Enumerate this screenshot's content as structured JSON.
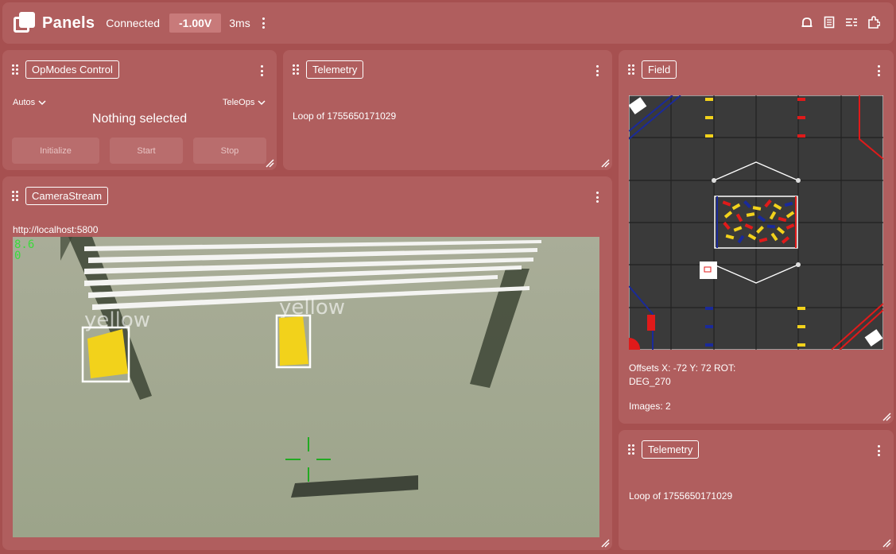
{
  "app": {
    "brand": "Panels",
    "status": "Connected",
    "voltage": "-1.00V",
    "latency": "3ms"
  },
  "toolbar_icons": [
    "bell-icon",
    "document-icon",
    "list-settings-icon",
    "puzzle-icon"
  ],
  "opmodes": {
    "title": "OpModes Control",
    "autos_label": "Autos",
    "teleops_label": "TeleOps",
    "selection": "Nothing selected",
    "initialize_label": "Initialize",
    "start_label": "Start",
    "stop_label": "Stop"
  },
  "telemetry_top": {
    "title": "Telemetry",
    "line": "Loop of 1755650171029"
  },
  "camera": {
    "title": "CameraStream",
    "url": "http://localhost:5800",
    "fps_overlay": "8.6\n0",
    "detections": [
      {
        "label": "yellow"
      },
      {
        "label": "yellow"
      }
    ]
  },
  "field": {
    "title": "Field",
    "offsets": "Offsets X: -72 Y: 72 ROT:",
    "rotation": "DEG_270",
    "images": "Images: 2"
  },
  "telemetry_bottom": {
    "title": "Telemetry",
    "line": "Loop of 1755650171029"
  },
  "colors": {
    "background": "#a65050",
    "panel": "#b05e5e",
    "field_tile": "#3a3a3a",
    "alliance_red": "#e01a1a",
    "alliance_blue": "#1a2a9a",
    "sample_yellow": "#f2d21b"
  }
}
